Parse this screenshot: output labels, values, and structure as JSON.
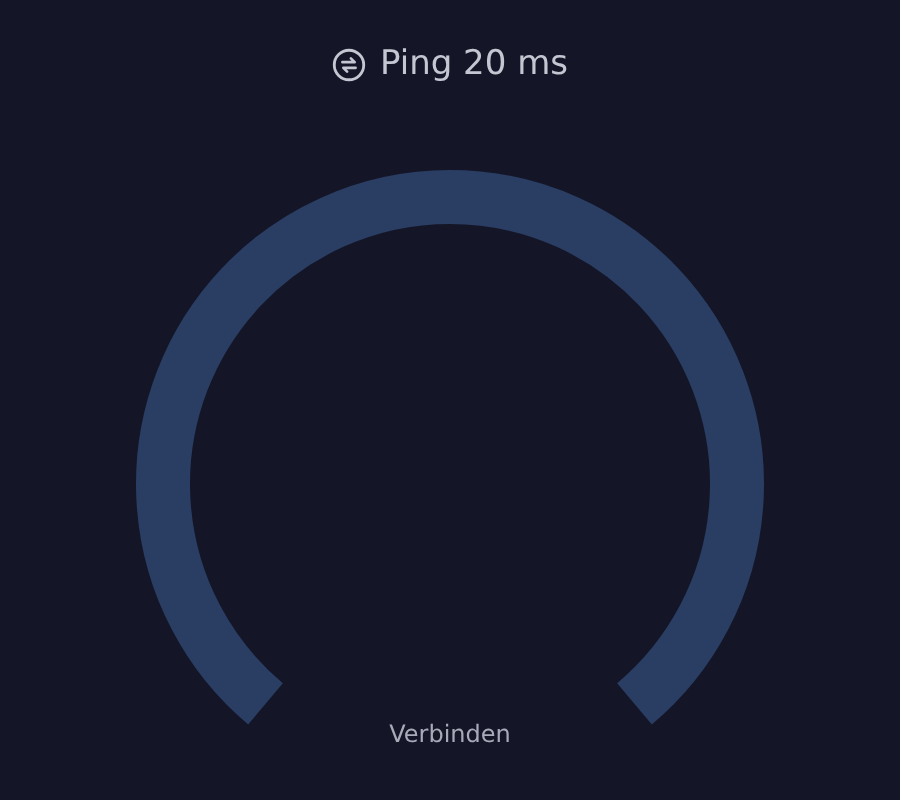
{
  "header": {
    "text": "Ping 20 ms"
  },
  "status": {
    "text": "Verbinden"
  }
}
